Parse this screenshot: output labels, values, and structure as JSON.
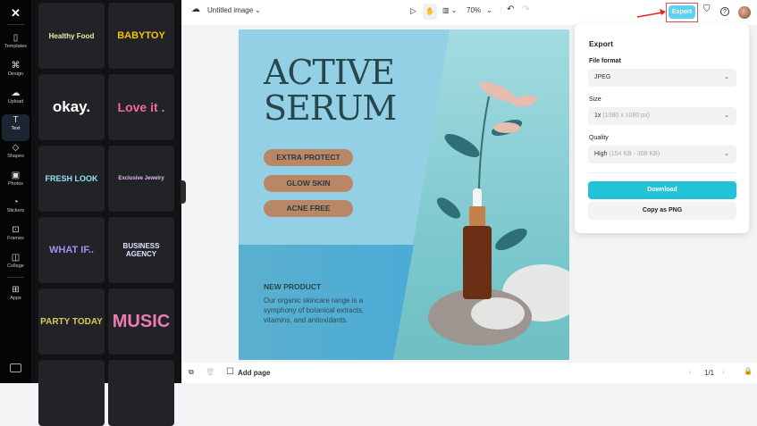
{
  "rail": {
    "items": [
      {
        "label": "Templates",
        "icon": "▯"
      },
      {
        "label": "Design",
        "icon": "⌘"
      },
      {
        "label": "Upload",
        "icon": "☁"
      },
      {
        "label": "Text",
        "icon": "T"
      },
      {
        "label": "Shapes",
        "icon": "◇"
      },
      {
        "label": "Photos",
        "icon": "▣"
      },
      {
        "label": "Stickers",
        "icon": "◔"
      },
      {
        "label": "Frames",
        "icon": "⊡"
      },
      {
        "label": "Collage",
        "icon": "◫"
      },
      {
        "label": "Apps",
        "icon": "⊞"
      }
    ]
  },
  "panel": {
    "cards": [
      {
        "text": "Healthy Food",
        "color": "#e9f0a8"
      },
      {
        "text": "BABYTOY",
        "color": "#f5c400"
      },
      {
        "text": "okay.",
        "color": "#ffffff"
      },
      {
        "text": "Love it .",
        "color": "#f06a9a"
      },
      {
        "text": "FRESH LOOK",
        "color": "#8fe4f5"
      },
      {
        "text": "Exclusive Jewelry",
        "color": "#e4b8f0"
      },
      {
        "text": "WHAT IF..",
        "color": "#a88ef0"
      },
      {
        "text": "BUSINESS AGENCY",
        "color": "#e0e4ff"
      },
      {
        "text": "PARTY TODAY",
        "color": "#d8c860"
      },
      {
        "text": "MUSIC",
        "color": "#f07ab4"
      },
      {
        "text": "",
        "color": "#fff"
      },
      {
        "text": "",
        "color": "#fff"
      }
    ]
  },
  "topbar": {
    "title": "Untitled image",
    "zoom": "70%",
    "export": "Export"
  },
  "design": {
    "title_line1": "ACTIVE",
    "title_line2": "SERUM",
    "pills": [
      "EXTRA PROTECT",
      "GLOW SKIN",
      "ACNE FREE"
    ],
    "new_product": "NEW PRODUCT",
    "description": "Our organic skincare range is a symphony of botanical extracts, vitamins, and antioxidants."
  },
  "export_panel": {
    "heading": "Export",
    "file_format_label": "File format",
    "file_format": "JPEG",
    "size_label": "Size",
    "size_value": "1x",
    "size_detail": "(1080 x 1080 px)",
    "quality_label": "Quality",
    "quality_value": "High",
    "quality_detail": "(154 KB - 308 KB)",
    "download": "Download",
    "copy_png": "Copy as PNG"
  },
  "bottombar": {
    "add_page": "Add page",
    "page_indicator": "1/1"
  },
  "colors": {
    "accent": "#22c3d6",
    "export_btn": "#5fd0ee"
  }
}
